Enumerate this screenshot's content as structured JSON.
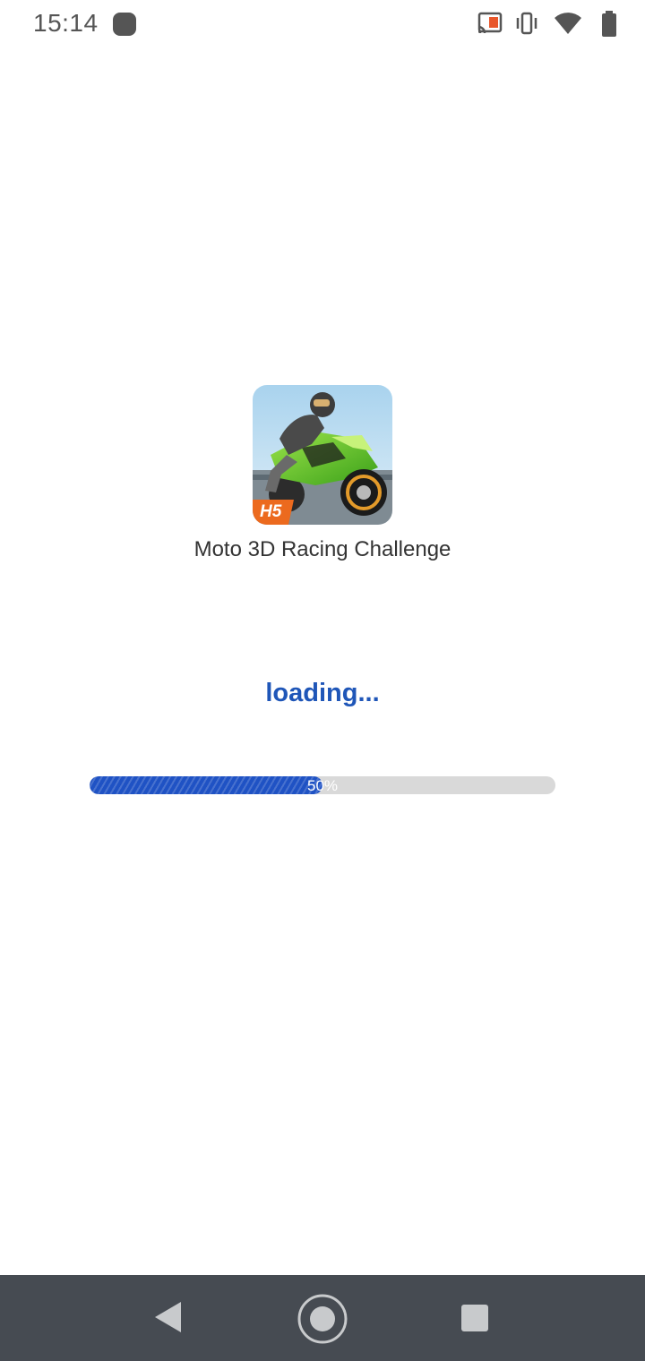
{
  "status_bar": {
    "time": "15:14",
    "icons": [
      "notification-dot-icon",
      "cast-icon",
      "vibrate-icon",
      "wifi-icon",
      "battery-icon"
    ]
  },
  "splash": {
    "app_name": "Moto 3D Racing Challenge",
    "icon_badge": "H5",
    "loading_text": "loading...",
    "progress_percent": 50,
    "progress_label": "50%",
    "colors": {
      "accent": "#1f56b8",
      "track": "#d9d9d9"
    }
  },
  "nav_bar": {
    "buttons": [
      "back-icon",
      "home-icon",
      "recents-icon"
    ]
  }
}
